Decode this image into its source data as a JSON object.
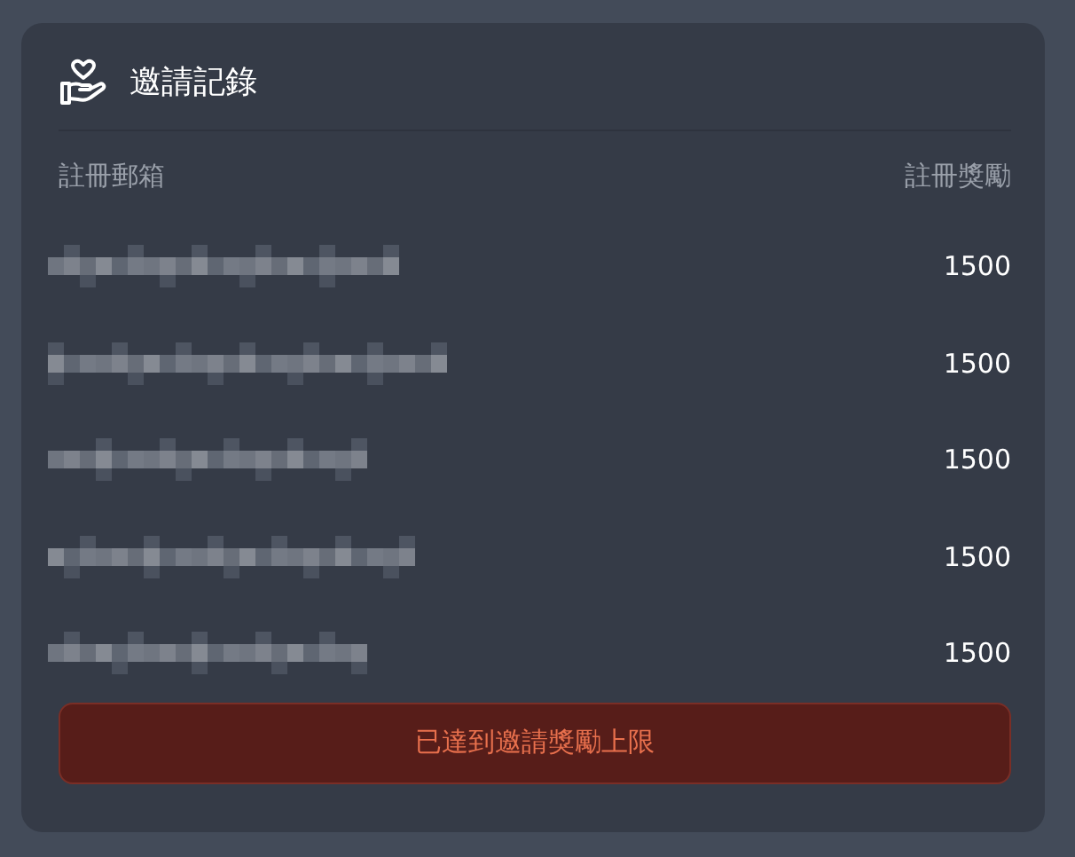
{
  "card": {
    "title": "邀請記錄"
  },
  "table": {
    "columns": [
      "註冊郵箱",
      "註冊獎勵"
    ],
    "rows": [
      {
        "kind": "redacted",
        "reward": "1500"
      },
      {
        "kind": "redacted",
        "reward": "1500"
      },
      {
        "kind": "redacted",
        "reward": "1500"
      },
      {
        "kind": "redacted",
        "reward": "1500"
      },
      {
        "kind": "redacted",
        "reward": "1500"
      }
    ]
  },
  "notice_button": {
    "label": "已達到邀請獎勵上限",
    "disabled": true
  }
}
